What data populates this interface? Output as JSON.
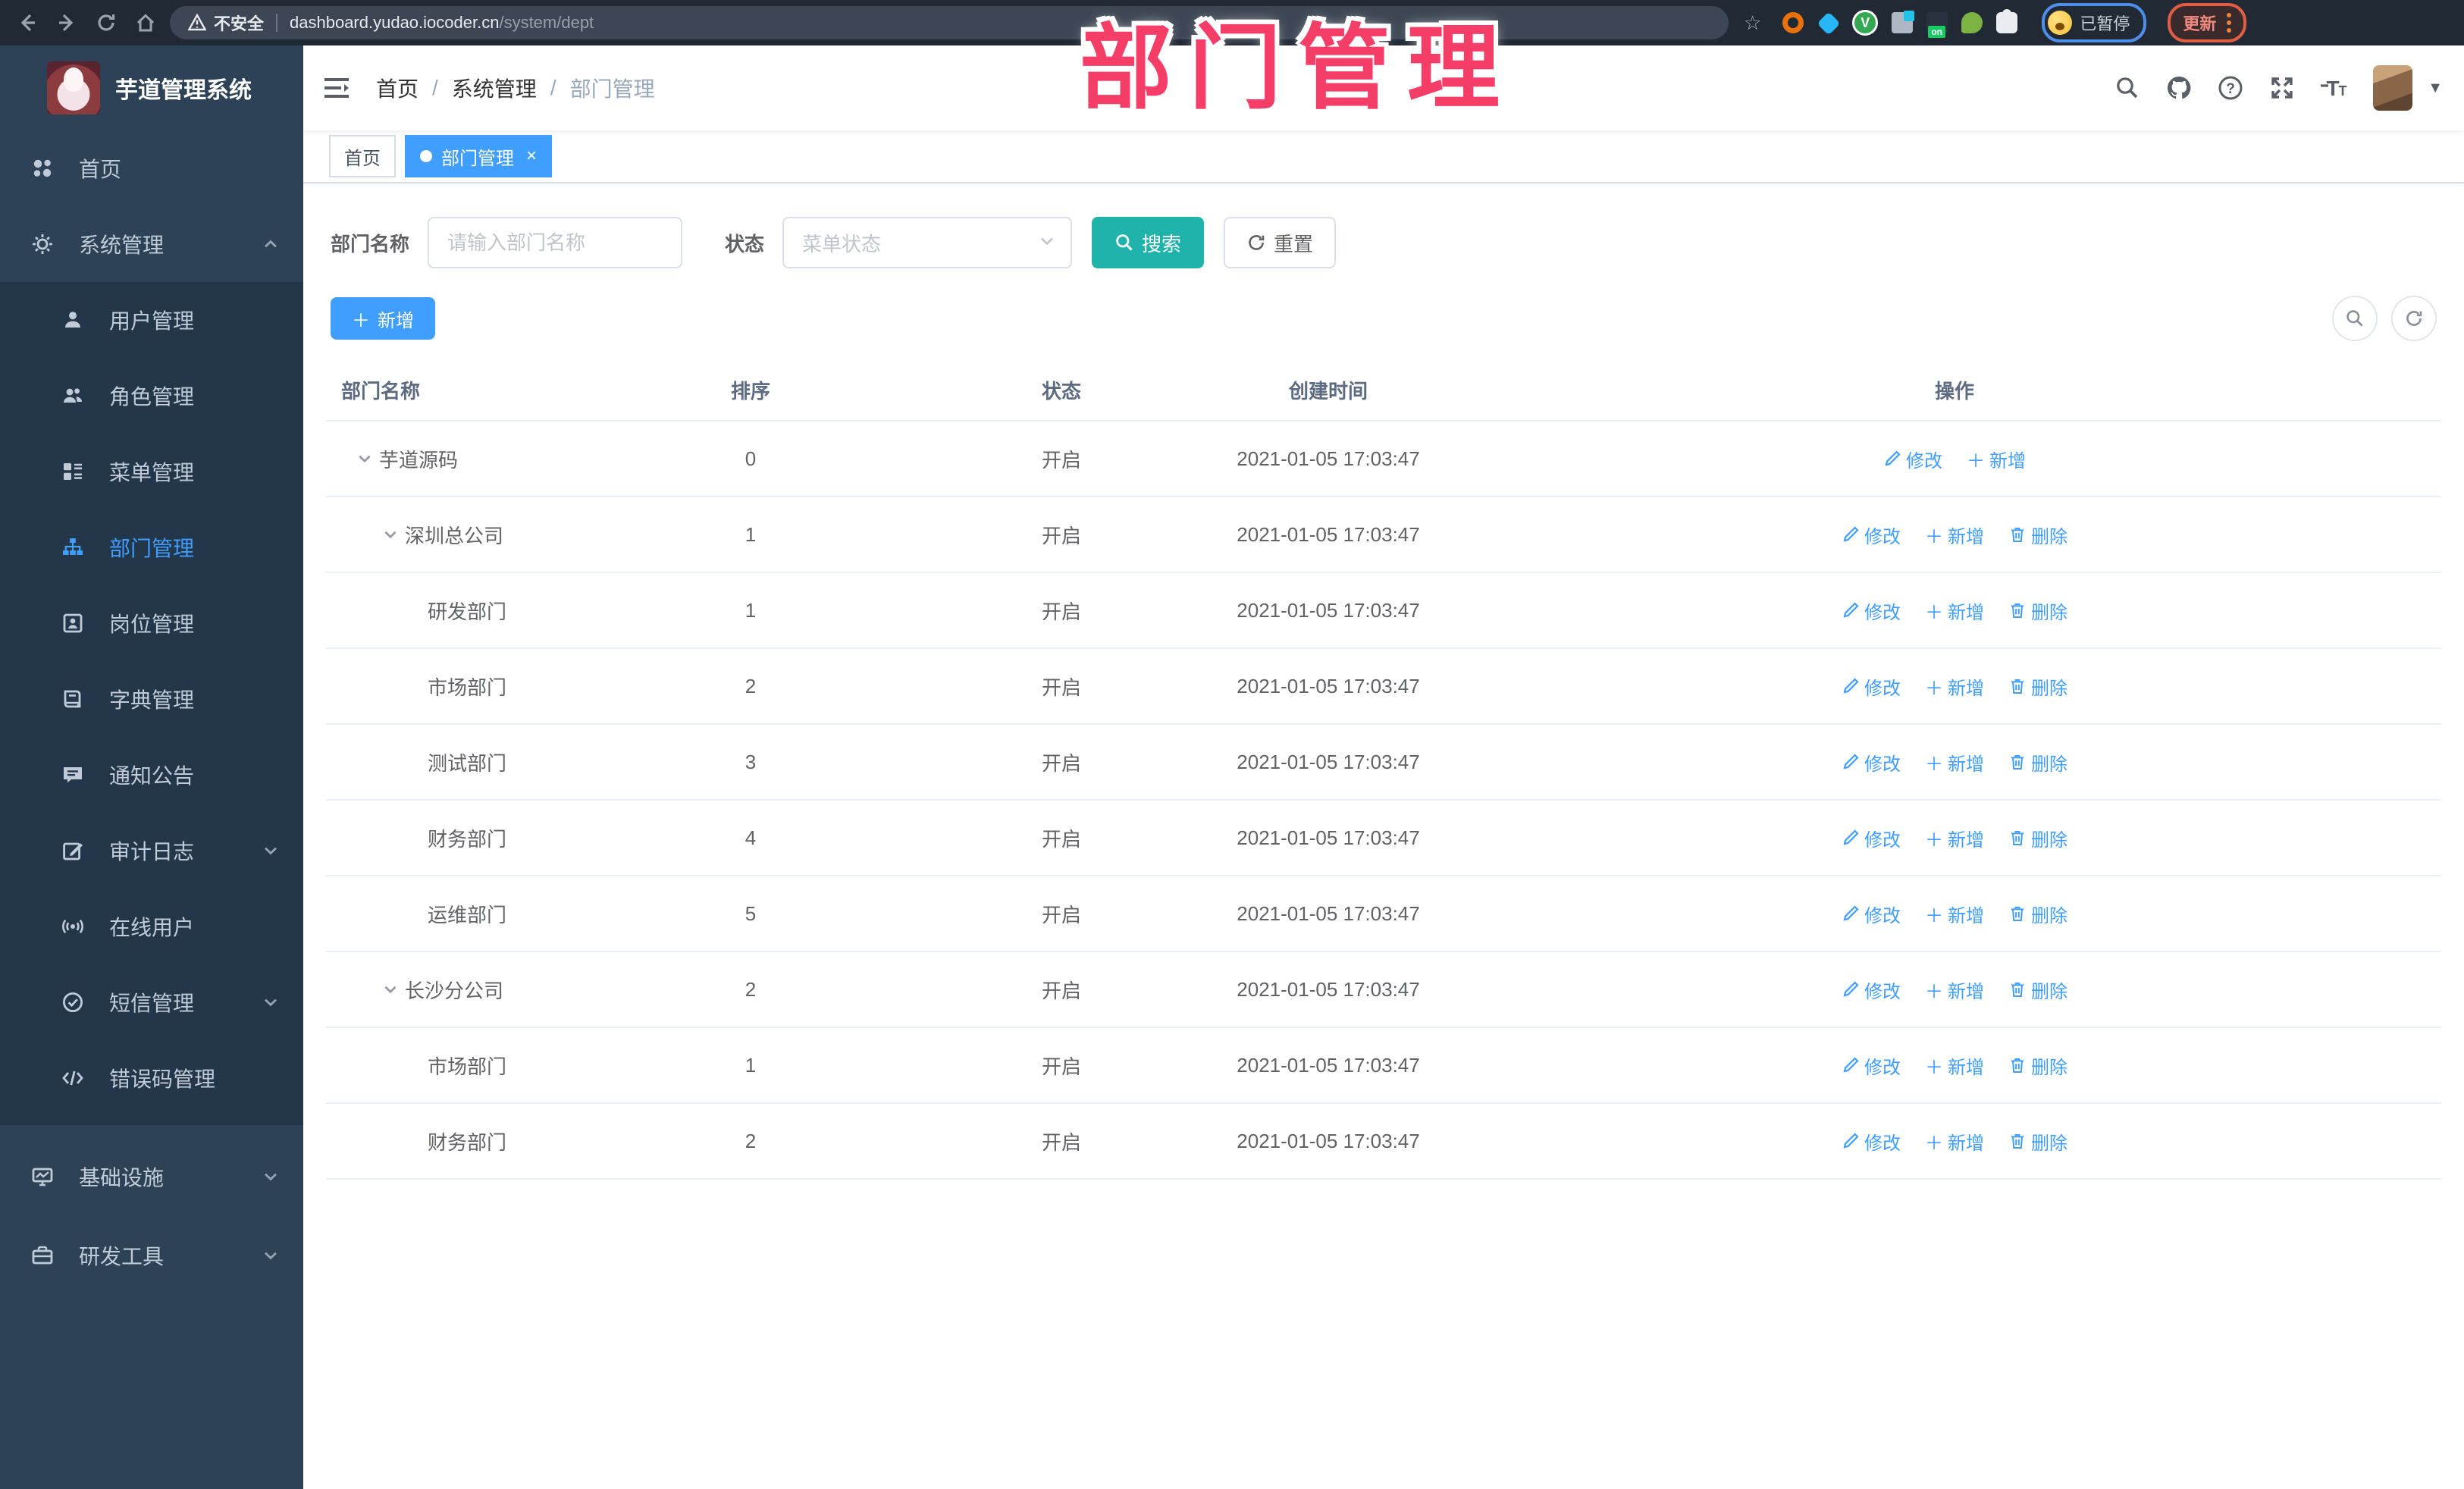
{
  "browser": {
    "security_label": "不安全",
    "url_domain": "dashboard.yudao.iocoder.cn",
    "url_path": "/system/dept",
    "profile_status": "已暂停",
    "update_label": "更新"
  },
  "overlay": {
    "title": "部门管理"
  },
  "colors": {
    "accent_blue": "#409EFF",
    "search_teal": "#1fb3ac",
    "overlay_pink": "#f43e67",
    "sidebar_bg": "#2d4257",
    "submenu_bg": "#24364a",
    "browser_bar": "#212935"
  },
  "sidebar": {
    "title": "芋道管理系统",
    "items": [
      {
        "label": "首页"
      },
      {
        "label": "系统管理"
      },
      {
        "label": "用户管理"
      },
      {
        "label": "角色管理"
      },
      {
        "label": "菜单管理"
      },
      {
        "label": "部门管理"
      },
      {
        "label": "岗位管理"
      },
      {
        "label": "字典管理"
      },
      {
        "label": "通知公告"
      },
      {
        "label": "审计日志"
      },
      {
        "label": "在线用户"
      },
      {
        "label": "短信管理"
      },
      {
        "label": "错误码管理"
      },
      {
        "label": "基础设施"
      },
      {
        "label": "研发工具"
      }
    ]
  },
  "breadcrumb": [
    "首页",
    "系统管理",
    "部门管理"
  ],
  "tabs": [
    {
      "label": "首页",
      "active": false
    },
    {
      "label": "部门管理",
      "active": true
    }
  ],
  "filter": {
    "name_label": "部门名称",
    "name_placeholder": "请输入部门名称",
    "status_label": "状态",
    "status_placeholder": "菜单状态",
    "search_label": "搜索",
    "reset_label": "重置"
  },
  "toolbar": {
    "add_label": "新增"
  },
  "table": {
    "headers": {
      "name": "部门名称",
      "sort": "排序",
      "status": "状态",
      "created": "创建时间",
      "actions": "操作"
    },
    "action_labels": {
      "edit": "修改",
      "add": "新增",
      "delete": "删除"
    },
    "rows": [
      {
        "name": "芋道源码",
        "sort": "0",
        "status": "开启",
        "created": "2021-01-05 17:03:47"
      },
      {
        "name": "深圳总公司",
        "sort": "1",
        "status": "开启",
        "created": "2021-01-05 17:03:47"
      },
      {
        "name": "研发部门",
        "sort": "1",
        "status": "开启",
        "created": "2021-01-05 17:03:47"
      },
      {
        "name": "市场部门",
        "sort": "2",
        "status": "开启",
        "created": "2021-01-05 17:03:47"
      },
      {
        "name": "测试部门",
        "sort": "3",
        "status": "开启",
        "created": "2021-01-05 17:03:47"
      },
      {
        "name": "财务部门",
        "sort": "4",
        "status": "开启",
        "created": "2021-01-05 17:03:47"
      },
      {
        "name": "运维部门",
        "sort": "5",
        "status": "开启",
        "created": "2021-01-05 17:03:47"
      },
      {
        "name": "长沙分公司",
        "sort": "2",
        "status": "开启",
        "created": "2021-01-05 17:03:47"
      },
      {
        "name": "市场部门",
        "sort": "1",
        "status": "开启",
        "created": "2021-01-05 17:03:47"
      },
      {
        "name": "财务部门",
        "sort": "2",
        "status": "开启",
        "created": "2021-01-05 17:03:47"
      }
    ]
  }
}
